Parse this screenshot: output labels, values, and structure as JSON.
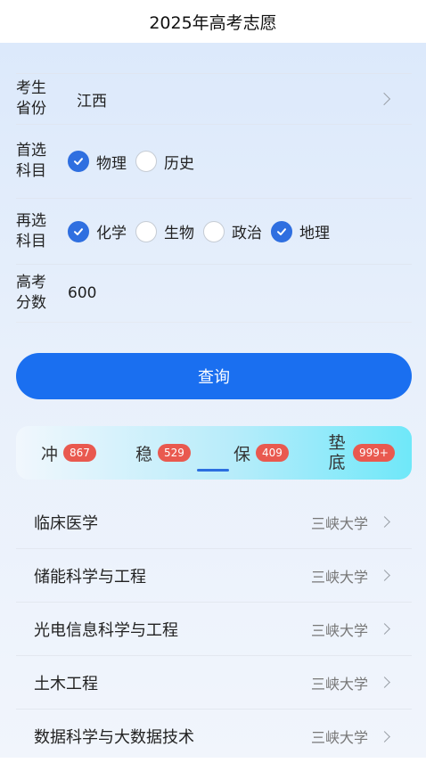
{
  "header": {
    "title": "2025年高考志愿"
  },
  "form": {
    "province": {
      "label": "考生省份",
      "value": "江西"
    },
    "first_subject": {
      "label": "首选科目",
      "options": [
        {
          "label": "物理",
          "checked": true
        },
        {
          "label": "历史",
          "checked": false
        }
      ]
    },
    "second_subject": {
      "label": "再选科目",
      "options": [
        {
          "label": "化学",
          "checked": true
        },
        {
          "label": "生物",
          "checked": false
        },
        {
          "label": "政治",
          "checked": false
        },
        {
          "label": "地理",
          "checked": true
        }
      ]
    },
    "score": {
      "label": "高考分数",
      "value": "600"
    }
  },
  "query_button": "查询",
  "tabs": [
    {
      "label": "冲",
      "count": "867"
    },
    {
      "label": "稳",
      "count": "529"
    },
    {
      "label": "保",
      "count": "409",
      "active": true
    },
    {
      "label": "垫底",
      "count": "999+"
    }
  ],
  "results": [
    {
      "major": "临床医学",
      "school": "三峡大学"
    },
    {
      "major": "储能科学与工程",
      "school": "三峡大学"
    },
    {
      "major": "光电信息科学与工程",
      "school": "三峡大学"
    },
    {
      "major": "土木工程",
      "school": "三峡大学"
    },
    {
      "major": "数据科学与大数据技术",
      "school": "三峡大学"
    }
  ],
  "colors": {
    "accent": "#1a6ff0",
    "badge": "#e9594f",
    "checked": "#2f6fe0"
  }
}
